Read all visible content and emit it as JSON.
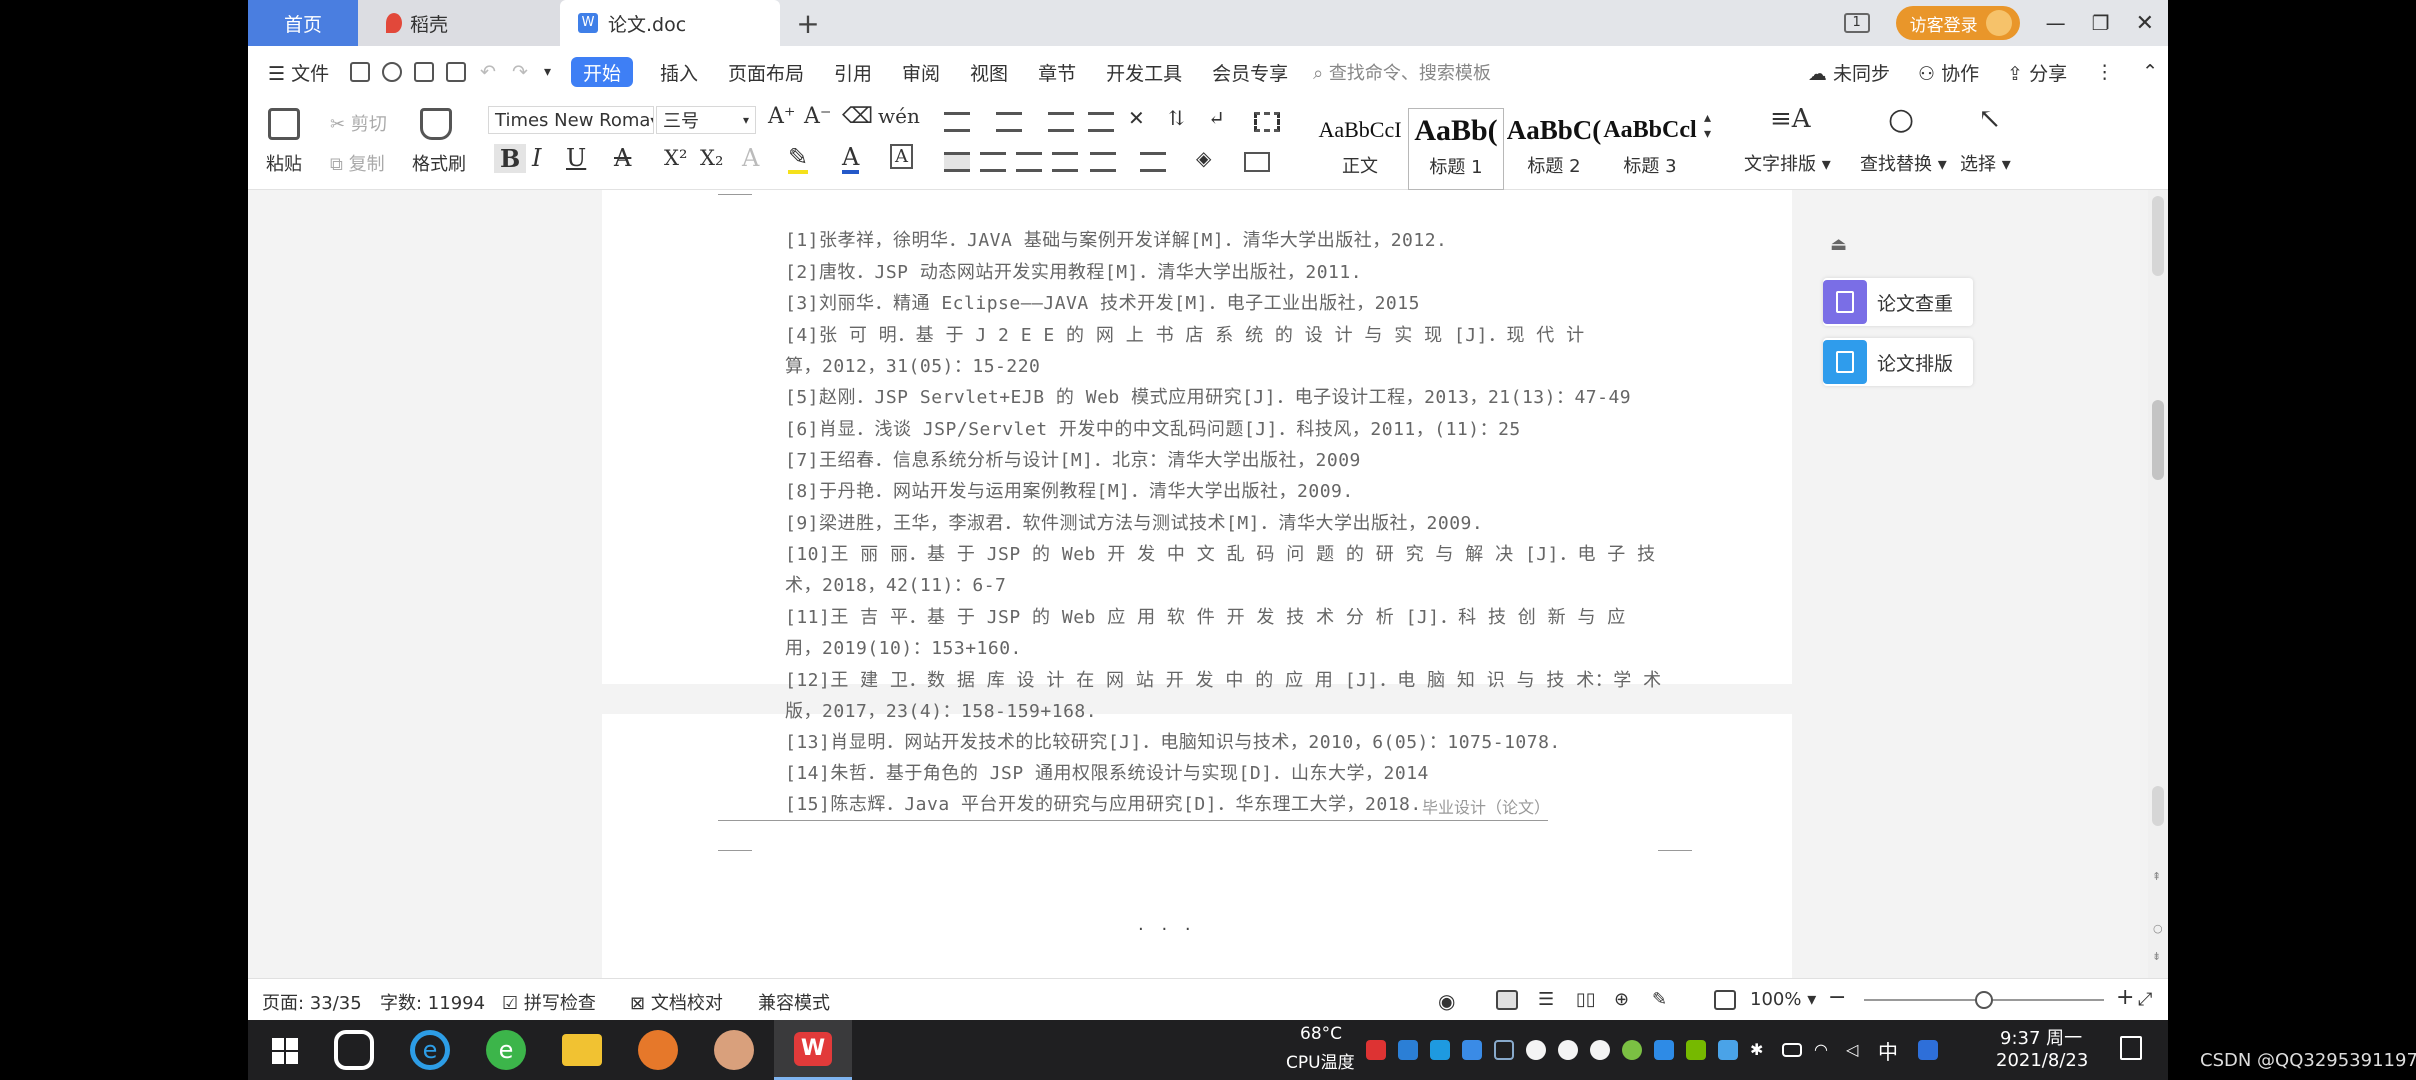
{
  "tabs": {
    "home": "首页",
    "docer": "稻壳",
    "doc": "论文.doc",
    "add": "+"
  },
  "window": {
    "login": "访客登录",
    "badge": "1",
    "minimize": "—",
    "restore": "❐",
    "close": "✕"
  },
  "menu": {
    "file": "文件",
    "items": [
      "开始",
      "插入",
      "页面布局",
      "引用",
      "审阅",
      "视图",
      "章节",
      "开发工具",
      "会员专享"
    ],
    "search_placeholder": "查找命令、搜索模板",
    "sync": "未同步",
    "collab": "协作",
    "share": "分享"
  },
  "ribbon": {
    "paste": "粘贴",
    "cut": "剪切",
    "copy": "复制",
    "format_painter": "格式刷",
    "font_name": "Times New Roma",
    "font_size": "三号",
    "bold": "B",
    "italic": "I",
    "underline": "U",
    "strike": "A",
    "sup": "X²",
    "sub": "X₂",
    "styles": [
      {
        "preview": "AaBbCcI",
        "name": "正文"
      },
      {
        "preview": "AaBb(",
        "name": "标题 1"
      },
      {
        "preview": "AaBbC(",
        "name": "标题 2"
      },
      {
        "preview": "AaBbCcl",
        "name": "标题 3"
      }
    ],
    "text_layout": "文字排版",
    "find_replace": "查找替换",
    "select": "选择"
  },
  "document": {
    "references_page1": [
      "[1]张孝祥，徐明华．JAVA 基础与案例开发详解[M]．清华大学出版社，2012.",
      "[2]唐牧．JSP 动态网站开发实用教程[M]．清华大学出版社，2011.",
      "[3]刘丽华．精通 Eclipse——JAVA 技术开发[M]．电子工业出版社，2015",
      "[4]张 可 明．基 于 J 2 E E 的 网 上 书 店 系 统 的 设 计 与 实 现 [J]．现 代 计",
      "算，2012，31(05)：15-220",
      "[5]赵刚．JSP Servlet+EJB 的 Web 模式应用研究[J]．电子设计工程，2013，21(13)：47-49",
      "[6]肖显．浅谈 JSP/Servlet 开发中的中文乱码问题[J]．科技风，2011，(11)：25",
      "[7]王绍春．信息系统分析与设计[M]．北京：清华大学出版社，2009",
      "[8]于丹艳．网站开发与运用案例教程[M]．清华大学出版社，2009.",
      "[9]梁进胜，王华，李淑君．软件测试方法与测试技术[M]．清华大学出版社，2009.",
      "[10]王 丽 丽．基 于 JSP 的 Web 开 发 中 文 乱 码 问 题 的 研 究 与 解 决 [J]．电 子 技",
      "术，2018，42(11)：6-7",
      "[11]王 吉 平．基 于 JSP 的 Web 应 用 软 件 开 发 技 术 分 析 [J]．科 技 创 新 与 应",
      "用，2019(10)：153+160.",
      "[12]王 建 卫．数 据 库 设 计 在 网 站 开 发 中 的 应 用 [J]．电 脑 知 识 与 技 术：学 术",
      "版，2017，23(4)：158-159+168."
    ],
    "references_page2": [
      "[13]肖显明．网站开发技术的比较研究[J]．电脑知识与技术，2010，6(05)：1075-1078.",
      "[14]朱哲．基于角色的 JSP 通用权限系统设计与实现[D]．山东大学，2014",
      "[15]陈志辉．Java 平台开发的研究与应用研究[D]．华东理工大学，2018."
    ],
    "footer_note": "毕业设计（论文）",
    "page_dots": ". . ."
  },
  "side_panel": {
    "check": "论文查重",
    "layout": "论文排版"
  },
  "status": {
    "page": "页面: 33/35",
    "words": "字数: 11994",
    "spell": "拼写检查",
    "proof": "文档校对",
    "compat": "兼容模式",
    "zoom": "100%",
    "zoom_level": 0.5
  },
  "taskbar": {
    "cpu_temp": "68°C",
    "cpu_label": "CPU温度",
    "ime": "中",
    "time": "9:37 周一",
    "date": "2021/8/23"
  },
  "watermark": "CSDN @QQ3295391197",
  "colors": {
    "accent": "#3e7ff5",
    "home_tab": "#4a7ee0",
    "login": "#e9962a",
    "check_panel": "#7a6ee6",
    "layout_panel": "#2f9cec",
    "wps_red": "#e23a3a"
  }
}
